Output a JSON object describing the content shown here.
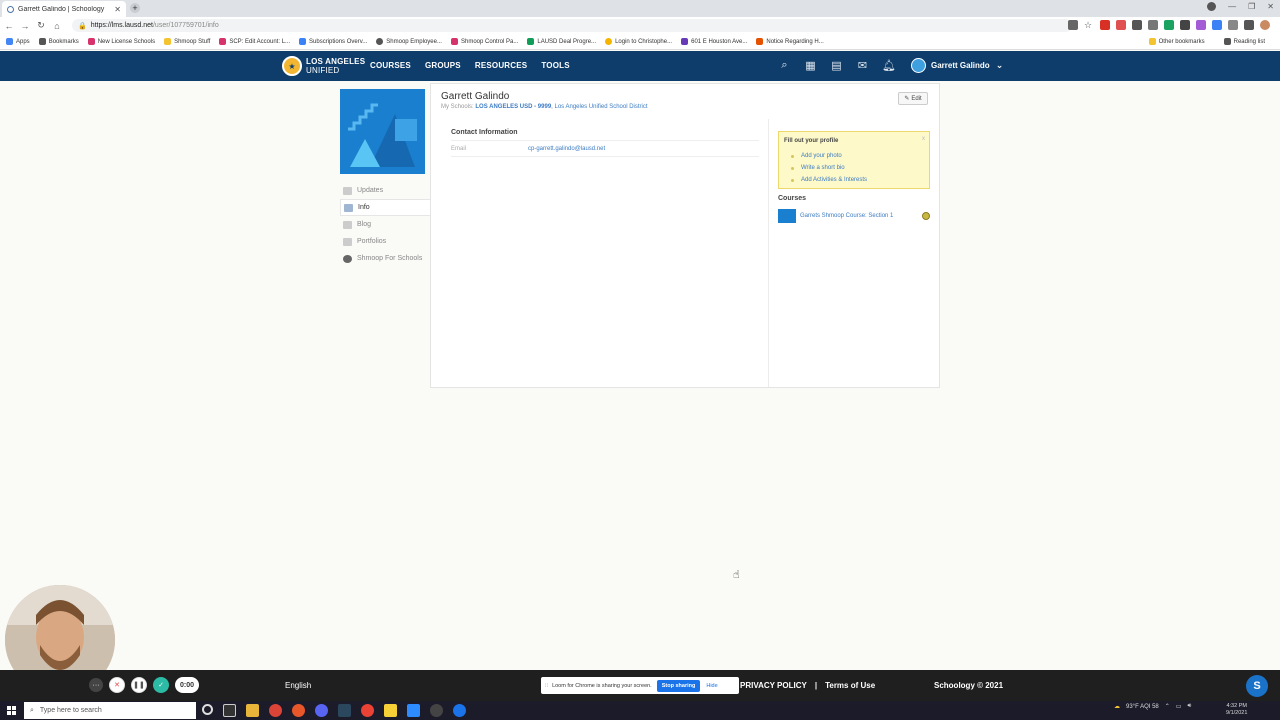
{
  "browser": {
    "tab_title": "Garrett Galindo | Schoology",
    "url_host": "https://lms.lausd.net",
    "url_path": "/user/107759701/info",
    "bookmarks": [
      "Apps",
      "Bookmarks",
      "New License Schools",
      "Shmoop Stuff",
      "SCP: Edit Account: L...",
      "Subscriptions Overv...",
      "Shmoop Employee...",
      "Shmoop Control Pa...",
      "LAUSD Deal Progre...",
      "Login to Christophe...",
      "601 E Houston Ave...",
      "Notice Regarding H..."
    ],
    "bookmarks_right": [
      "Other bookmarks",
      "Reading list"
    ]
  },
  "header": {
    "logo_text_line1": "LOS ANGELES",
    "logo_text_line2": "UNIFIED",
    "nav": [
      "COURSES",
      "GROUPS",
      "RESOURCES",
      "TOOLS"
    ],
    "user_name": "Garrett Galindo"
  },
  "sidebar": {
    "items": [
      {
        "label": "Updates"
      },
      {
        "label": "Info"
      },
      {
        "label": "Blog"
      },
      {
        "label": "Portfolios"
      },
      {
        "label": "Shmoop For Schools"
      }
    ]
  },
  "profile": {
    "name": "Garrett Galindo",
    "schools_prefix": "My Schools:",
    "school_primary": "LOS ANGELES USD - 9999",
    "school_secondary": ", Los Angeles Unified School District",
    "edit_label": "Edit",
    "contact_title": "Contact Information",
    "email_label": "Email",
    "email_value": "cp-garrett.galindo@lausd.net"
  },
  "fill_profile": {
    "title": "Fill out your profile",
    "close": "x",
    "items": [
      "Add your photo",
      "Write a short bio",
      "Add Activities & Interests"
    ]
  },
  "courses": {
    "title": "Courses",
    "items": [
      {
        "name": "Garrets Shmoop Course: Section 1"
      }
    ]
  },
  "loom": {
    "timer": "0:00",
    "share_text": "Loom for Chrome is sharing your screen.",
    "stop_label": "Stop sharing",
    "hide_label": "Hide"
  },
  "footer": {
    "language": "English",
    "privacy": "PRIVACY POLICY",
    "separator": "|",
    "terms": "Terms of Use",
    "copyright": "Schoology © 2021",
    "bubble": "S"
  },
  "taskbar": {
    "search_placeholder": "Type here to search",
    "weather": "93°F AQI 58",
    "time": "4:32 PM",
    "date": "9/1/2021"
  }
}
